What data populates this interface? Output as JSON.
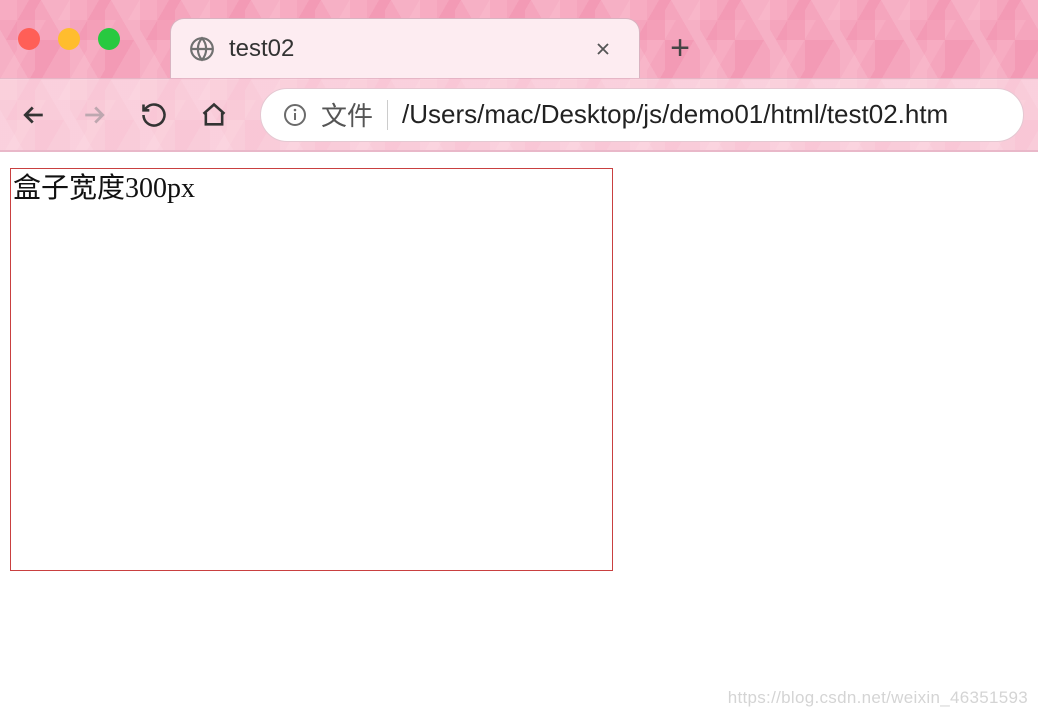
{
  "window": {
    "tab_title": "test02",
    "new_tab_tooltip": "New Tab"
  },
  "toolbar": {
    "address_scheme_label": "文件",
    "address_path": "/Users/mac/Desktop/js/demo01/html/test02.htm"
  },
  "page": {
    "box_text": "盒子宽度300px"
  },
  "watermark": "https://blog.csdn.net/weixin_46351593"
}
